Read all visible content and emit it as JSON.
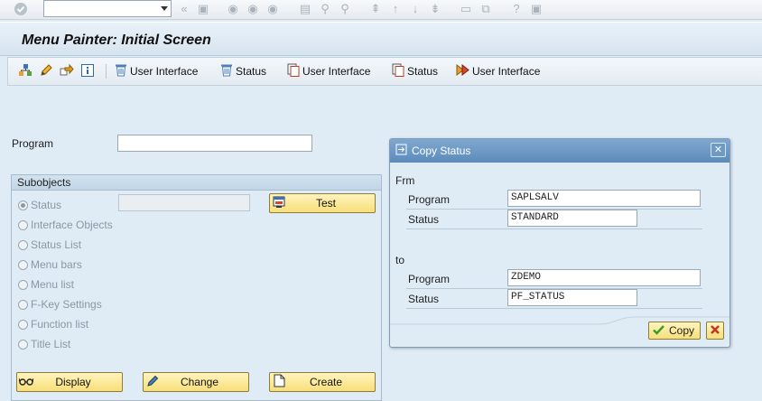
{
  "system_toolbar": {
    "icons": [
      "enter-icon",
      "back-icon",
      "save-icon",
      "back-nav-icon",
      "exit-icon",
      "cancel-icon",
      "print-icon",
      "find-icon",
      "find-next-icon",
      "first-page-icon",
      "prev-page-icon",
      "next-page-icon",
      "last-page-icon",
      "new-session-icon",
      "shortcut-icon",
      "help-icon",
      "layout-icon"
    ]
  },
  "title": "Menu Painter: Initial Screen",
  "app_toolbar": {
    "buttons": [
      {
        "icon": "hierarchy-icon",
        "label": ""
      },
      {
        "icon": "pencil-icon",
        "label": ""
      },
      {
        "icon": "arrow-right-icon",
        "label": ""
      },
      {
        "icon": "info-icon",
        "label": ""
      },
      {
        "icon": "delete-icon",
        "label": "User Interface"
      },
      {
        "icon": "delete-icon",
        "label": "Status"
      },
      {
        "icon": "copy-icon",
        "label": "User Interface"
      },
      {
        "icon": "copy-icon",
        "label": "Status"
      },
      {
        "icon": "generate-icon",
        "label": "User Interface"
      }
    ]
  },
  "program_label": "Program",
  "program_value": "",
  "subobjects": {
    "title": "Subobjects",
    "options": [
      {
        "label": "Status",
        "selected": true
      },
      {
        "label": "Interface Objects",
        "selected": false
      },
      {
        "label": "Status List",
        "selected": false
      },
      {
        "label": "Menu bars",
        "selected": false
      },
      {
        "label": "Menu list",
        "selected": false
      },
      {
        "label": "F-Key Settings",
        "selected": false
      },
      {
        "label": "Function list",
        "selected": false
      },
      {
        "label": "Title List",
        "selected": false
      }
    ],
    "status_value": "",
    "test_label": "Test",
    "display_label": "Display",
    "change_label": "Change",
    "create_label": "Create"
  },
  "dialog": {
    "title": "Copy Status",
    "from_label": "Frm",
    "to_label": "to",
    "from_program_label": "Program",
    "from_program_value": "SAPLSALV",
    "from_status_label": "Status",
    "from_status_value": "STANDARD",
    "to_program_label": "Program",
    "to_program_value": "ZDEMO",
    "to_status_label": "Status",
    "to_status_value": "PF_STATUS",
    "copy_label": "Copy"
  },
  "colors": {
    "background": "#dfebf5",
    "button": "#f8df7a",
    "dialog_header": "#5c8bbb",
    "cancel_red": "#c0392b",
    "check_green": "#3a9a2c"
  }
}
